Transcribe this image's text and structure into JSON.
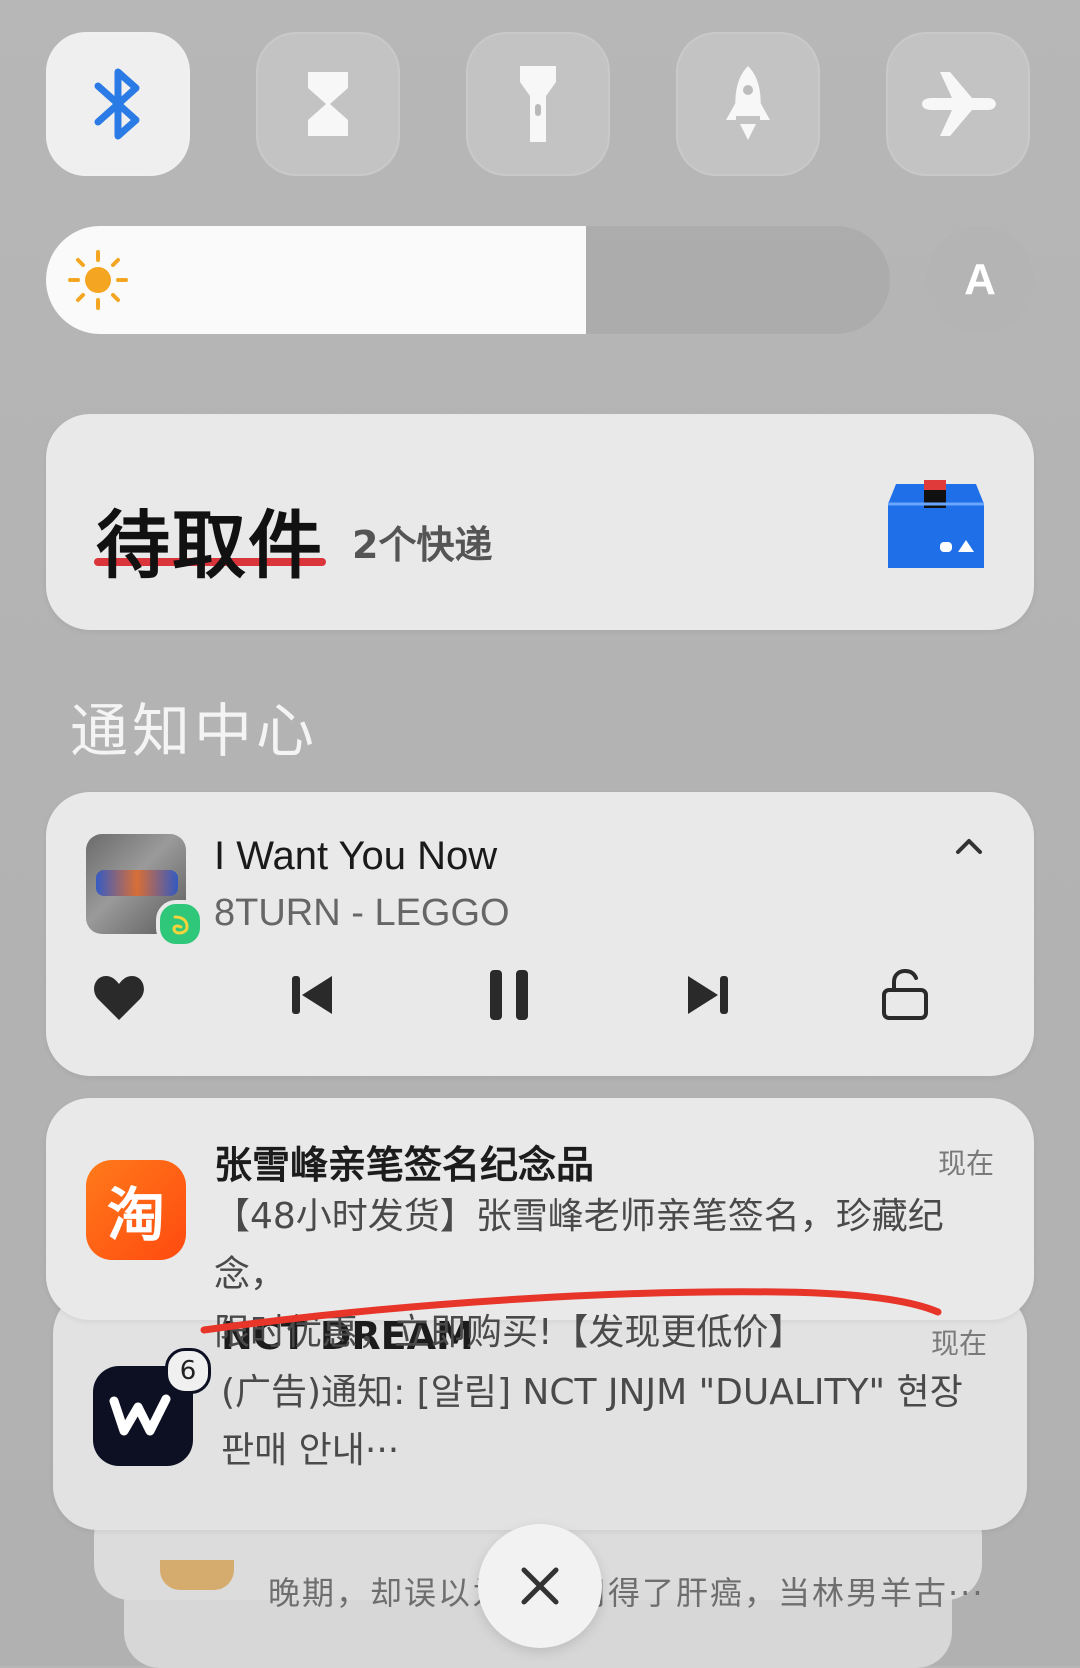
{
  "quick_tiles": [
    {
      "name": "bluetooth",
      "icon": "bluetooth-icon",
      "active": true
    },
    {
      "name": "hourglass",
      "icon": "hourglass-icon",
      "active": false
    },
    {
      "name": "flashlight",
      "icon": "flashlight-icon",
      "active": false
    },
    {
      "name": "rocket",
      "icon": "rocket-icon",
      "active": false
    },
    {
      "name": "airplane",
      "icon": "airplane-icon",
      "active": false
    }
  ],
  "brightness": {
    "level_percent": 64,
    "auto_label": "A"
  },
  "pickup_card": {
    "title": "待取件",
    "subtitle": "2个快递",
    "accent_color": "#1e6fe8"
  },
  "notification_center": {
    "title": "通知中心"
  },
  "music": {
    "song": "I Want You Now",
    "artist_line": "8TURN - LEGGO",
    "controls": [
      "heart-icon",
      "previous-icon",
      "pause-icon",
      "next-icon",
      "lock-icon"
    ]
  },
  "notifications": [
    {
      "app": "taobao",
      "app_icon_text": "淘",
      "title": "张雪峰亲笔签名纪念品",
      "time": "现在",
      "body_line1": "【48小时发货】张雪峰老师亲笔签名，珍藏纪念，",
      "body_line2": "限时优惠，立即购买!【发现更低价】"
    },
    {
      "app": "weverse",
      "badge_count": "6",
      "title": "NCT DREAM",
      "time": "现在",
      "body_line1": "(广告)通知: [알림] NCT JNJM \"DUALITY\" 현장",
      "body_line2": "판매 안내···"
    }
  ],
  "stacked_preview": {
    "text": "晚期，却误以为是存用得了肝癌，当林男羊古···"
  }
}
